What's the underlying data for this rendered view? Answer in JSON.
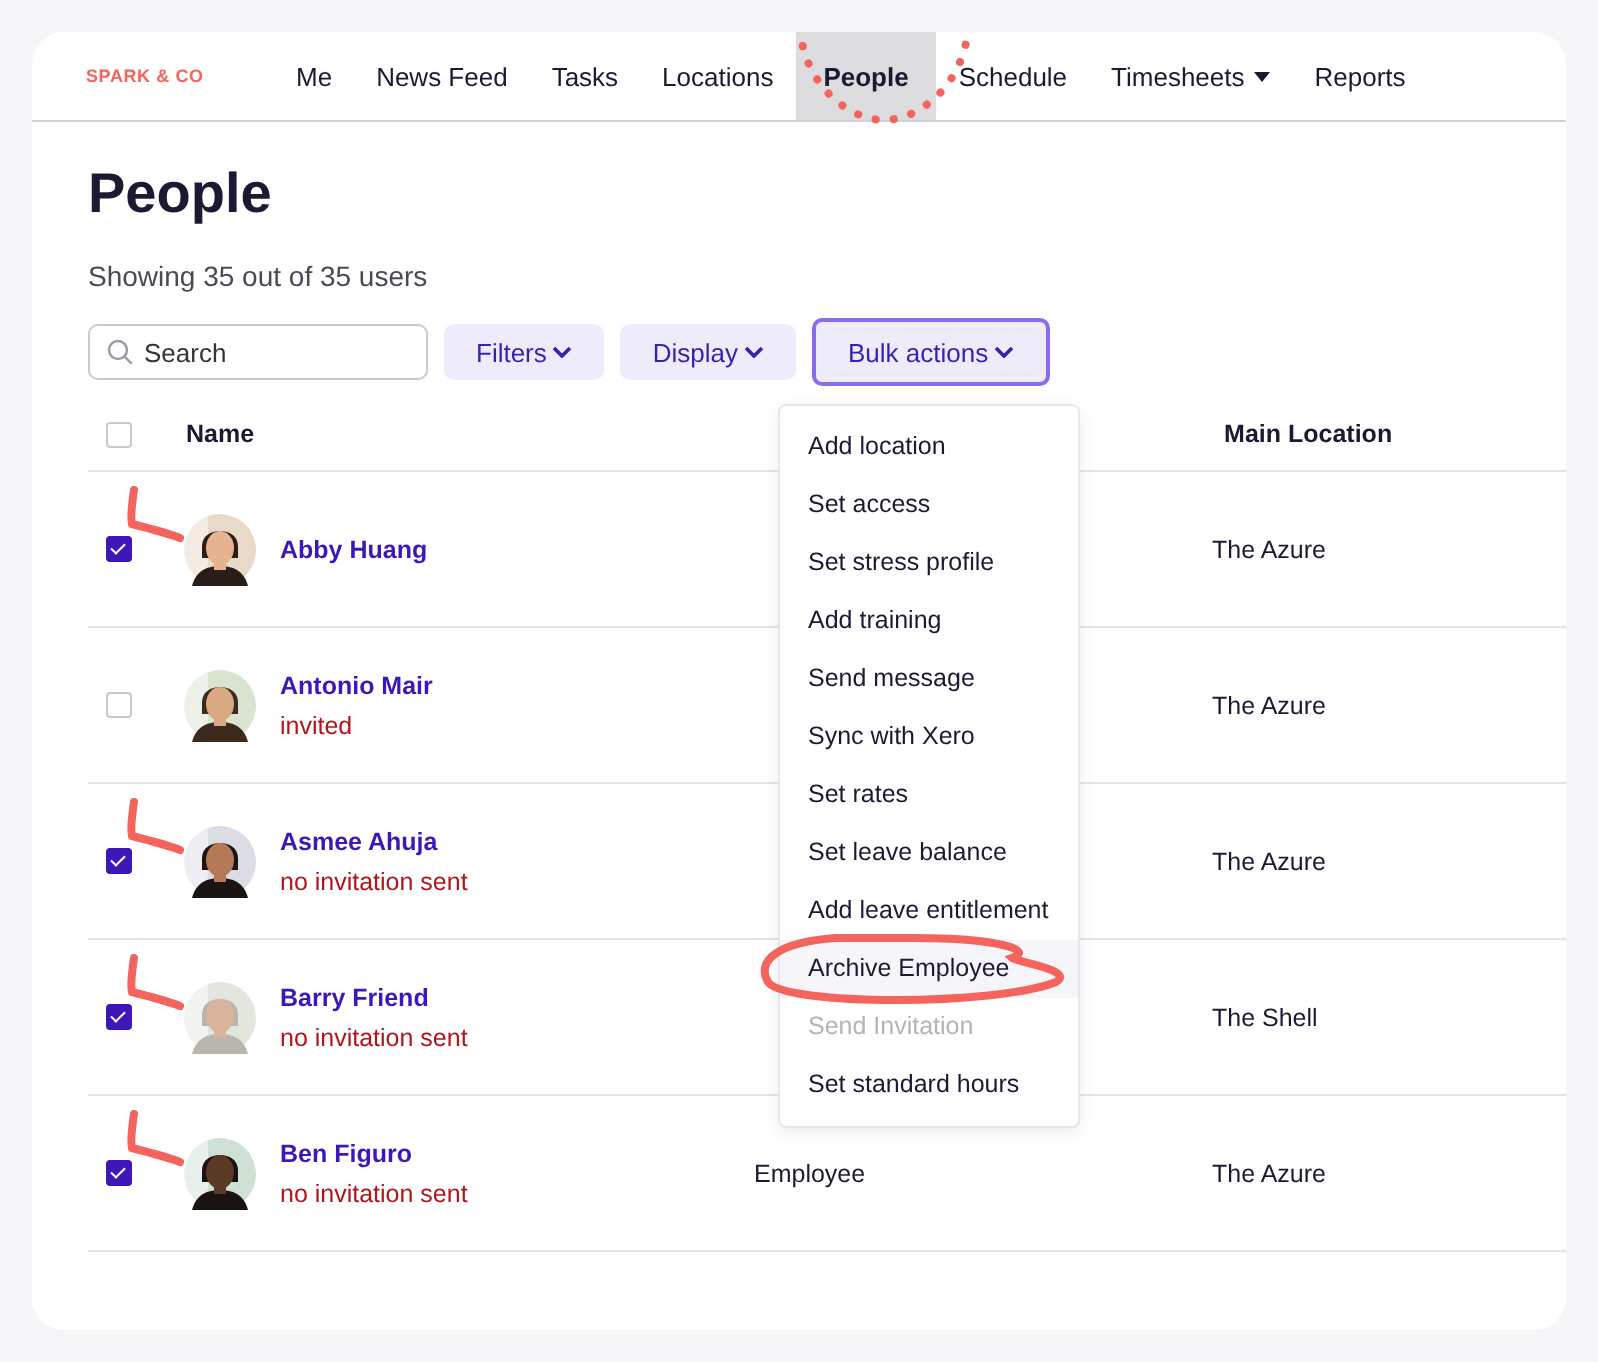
{
  "brand": "SPARK & CO",
  "nav": [
    {
      "label": "Me",
      "selected": false,
      "dropdown": false
    },
    {
      "label": "News Feed",
      "selected": false,
      "dropdown": false
    },
    {
      "label": "Tasks",
      "selected": false,
      "dropdown": false
    },
    {
      "label": "Locations",
      "selected": false,
      "dropdown": false
    },
    {
      "label": "People",
      "selected": true,
      "dropdown": false
    },
    {
      "label": "Schedule",
      "selected": false,
      "dropdown": false
    },
    {
      "label": "Timesheets",
      "selected": false,
      "dropdown": true
    },
    {
      "label": "Reports",
      "selected": false,
      "dropdown": false
    }
  ],
  "page_title": "People",
  "summary": "Showing 35 out of 35 users",
  "search": {
    "placeholder": "Search"
  },
  "toolbar": [
    {
      "label": "Filters",
      "selected": false
    },
    {
      "label": "Display",
      "selected": false
    },
    {
      "label": "Bulk actions",
      "selected": true
    }
  ],
  "table": {
    "all_checked": false,
    "columns": [
      "Name",
      "Main Location"
    ],
    "rows": [
      {
        "name": "Abby Huang",
        "checked": true,
        "location": "The Azure"
      },
      {
        "name": "Antonio Mair",
        "status": "invited",
        "checked": false,
        "location": "The Azure"
      },
      {
        "name": "Asmee Ahuja",
        "status": "no invitation sent",
        "checked": true,
        "location": "The Azure"
      },
      {
        "name": "Barry Friend",
        "status": "no invitation sent",
        "checked": true,
        "location": "The Shell"
      },
      {
        "name": "Ben Figuro",
        "status": "no invitation sent",
        "checked": true,
        "access": "Employee",
        "location": "The Azure"
      }
    ]
  },
  "bulk_menu": [
    {
      "label": "Add location",
      "disabled": false,
      "highlighted": false
    },
    {
      "label": "Set access",
      "disabled": false,
      "highlighted": false
    },
    {
      "label": "Set stress profile",
      "disabled": false,
      "highlighted": false
    },
    {
      "label": "Add training",
      "disabled": false,
      "highlighted": false
    },
    {
      "label": "Send message",
      "disabled": false,
      "highlighted": false
    },
    {
      "label": "Sync with Xero",
      "disabled": false,
      "highlighted": false
    },
    {
      "label": "Set rates",
      "disabled": false,
      "highlighted": false
    },
    {
      "label": "Set leave balance",
      "disabled": false,
      "highlighted": false
    },
    {
      "label": "Add leave entitlement",
      "disabled": false,
      "highlighted": false
    },
    {
      "label": "Archive Employee",
      "disabled": false,
      "highlighted": true
    },
    {
      "label": "Send Invitation",
      "disabled": true,
      "highlighted": false
    },
    {
      "label": "Set standard hours",
      "disabled": false,
      "highlighted": false
    }
  ]
}
